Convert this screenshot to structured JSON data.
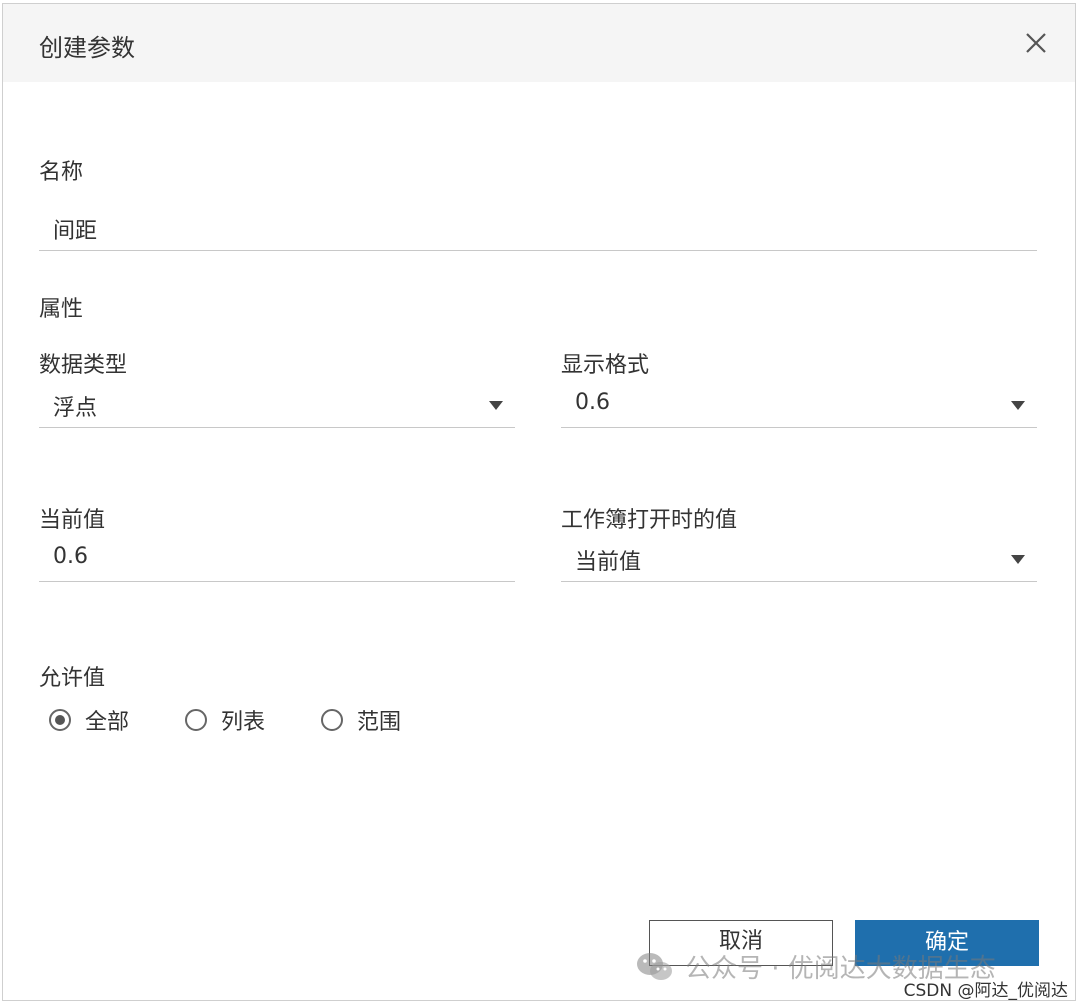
{
  "dialog": {
    "title": "创建参数"
  },
  "name_section": {
    "label": "名称",
    "value": "间距"
  },
  "properties": {
    "label": "属性",
    "data_type": {
      "label": "数据类型",
      "value": "浮点"
    },
    "display_format": {
      "label": "显示格式",
      "value": "0.6"
    },
    "current_value": {
      "label": "当前值",
      "value": "0.6"
    },
    "value_when_open": {
      "label": "工作簿打开时的值",
      "value": "当前值"
    }
  },
  "allowable_values": {
    "label": "允许值",
    "options": [
      {
        "label": "全部",
        "checked": true
      },
      {
        "label": "列表",
        "checked": false
      },
      {
        "label": "范围",
        "checked": false
      }
    ]
  },
  "buttons": {
    "cancel": "取消",
    "ok": "确定"
  },
  "watermark": {
    "text": "公众号 · 优阅达大数据生态",
    "icon": "wechat-icon"
  },
  "credit": "CSDN @阿达_优阅达",
  "colors": {
    "primary_button": "#1f6fad",
    "titlebar_bg": "#f5f5f5"
  }
}
